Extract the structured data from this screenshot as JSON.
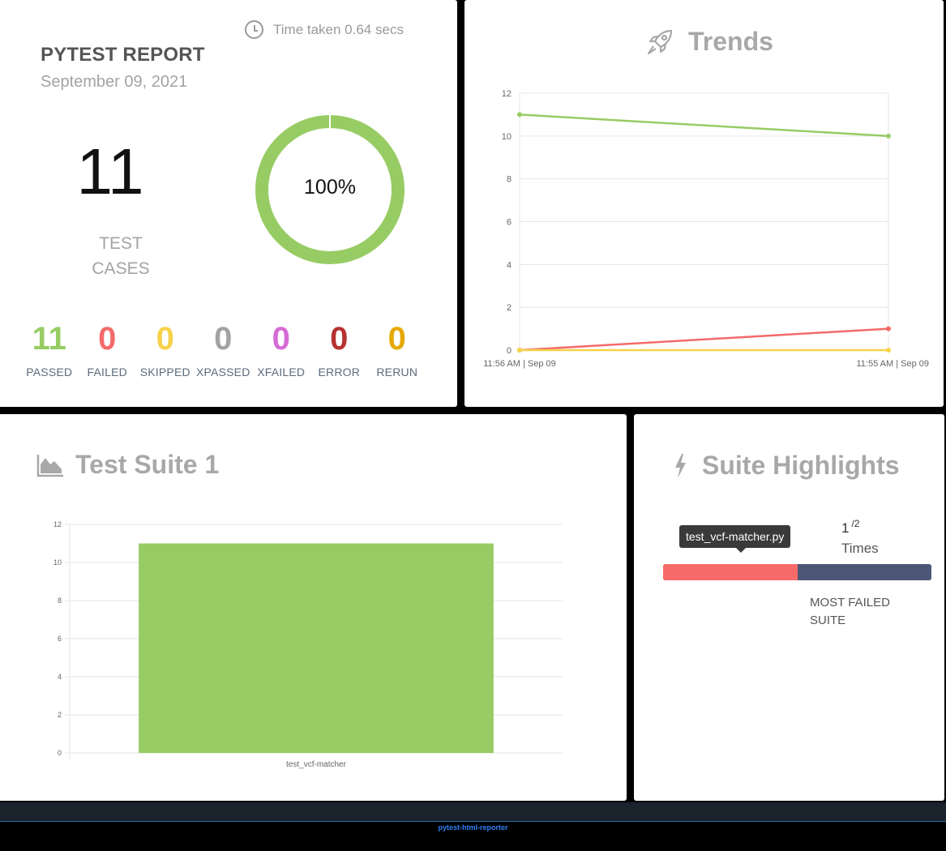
{
  "summary": {
    "time_taken": "Time taken 0.64 secs",
    "title": "PYTEST REPORT",
    "date": "September 09, 2021",
    "total": "11",
    "total_label_line1": "TEST",
    "total_label_line2": "CASES",
    "pass_percent": "100%",
    "pass_fraction": 1.0,
    "stats": [
      {
        "value": "11",
        "label": "PASSED",
        "color": "#97cc64"
      },
      {
        "value": "0",
        "label": "FAILED",
        "color": "#f46a6a"
      },
      {
        "value": "0",
        "label": "SKIPPED",
        "color": "#f7d24a"
      },
      {
        "value": "0",
        "label": "XPASSED",
        "color": "#a3a3a3"
      },
      {
        "value": "0",
        "label": "XFAILED",
        "color": "#d66bd6"
      },
      {
        "value": "0",
        "label": "ERROR",
        "color": "#b83232"
      },
      {
        "value": "0",
        "label": "RERUN",
        "color": "#e6a800"
      }
    ]
  },
  "trends": {
    "title": "Trends",
    "icon": "rocket-icon"
  },
  "suite": {
    "title": "Test Suite 1",
    "icon": "area-chart-icon"
  },
  "highlights": {
    "title": "Suite Highlights",
    "icon": "bolt-icon",
    "tooltip": "test_vcf-matcher.py",
    "times_value": "1",
    "times_total": "/2",
    "times_label": "Times",
    "failed_fraction": 0.5,
    "caption_line1": "MOST FAILED",
    "caption_line2": "SUITE",
    "colors": {
      "failed": "#f76a6a",
      "rest": "#4e5678"
    }
  },
  "footer": {
    "text": "pytest-html-reporter"
  },
  "chart_data": [
    {
      "type": "line",
      "title": "",
      "x": [
        "11:56 AM | Sep 09",
        "11:55 AM | Sep 09"
      ],
      "ylim": [
        0,
        12
      ],
      "yticks": [
        0,
        2,
        4,
        6,
        8,
        10,
        12
      ],
      "grid": true,
      "series": [
        {
          "name": "",
          "color": "#97cc64",
          "values": [
            11,
            10
          ]
        },
        {
          "name": "",
          "color": "#f46a6a",
          "values": [
            0,
            1
          ]
        },
        {
          "name": "",
          "color": "#f7d24a",
          "values": [
            0,
            0
          ]
        }
      ]
    },
    {
      "type": "bar",
      "title": "",
      "categories": [
        "test_vcf-matcher"
      ],
      "values": [
        11
      ],
      "color": "#97cc64",
      "ylim": [
        0,
        12
      ],
      "yticks": [
        0,
        2,
        4,
        6,
        8,
        10,
        12
      ],
      "grid": true
    }
  ]
}
